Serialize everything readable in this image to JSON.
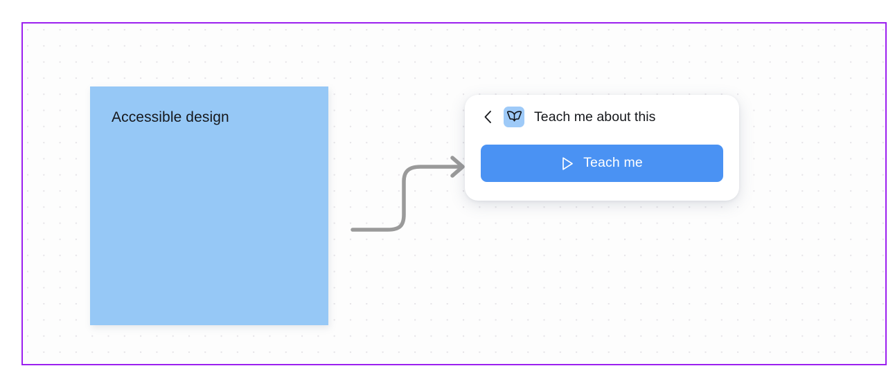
{
  "canvas": {
    "background_color": "#fdfdfd",
    "frame_border_color": "#9b1fef",
    "grid_dot_color": "#e6e4e8"
  },
  "sticky_note": {
    "text": "Accessible design",
    "fill_color": "#96c8f6",
    "text_color": "#16181c"
  },
  "connector": {
    "icon_name": "curved-arrow",
    "stroke_color": "#9a9a9a",
    "anchor_dot": {
      "icon_name": "anchor-dot",
      "ring_color": "#1a73f0",
      "core_color": "#ffffff"
    }
  },
  "popover": {
    "back_icon": "chevron-left-icon",
    "tile_icon": "open-book-icon",
    "tile_color": "#9ecaf8",
    "title": "Teach me about this",
    "title_color": "#15171b",
    "action_button": {
      "label": "Teach me",
      "icon_name": "play-triangle-icon",
      "background_color": "#4a92f3",
      "text_color": "#ffffff"
    }
  }
}
